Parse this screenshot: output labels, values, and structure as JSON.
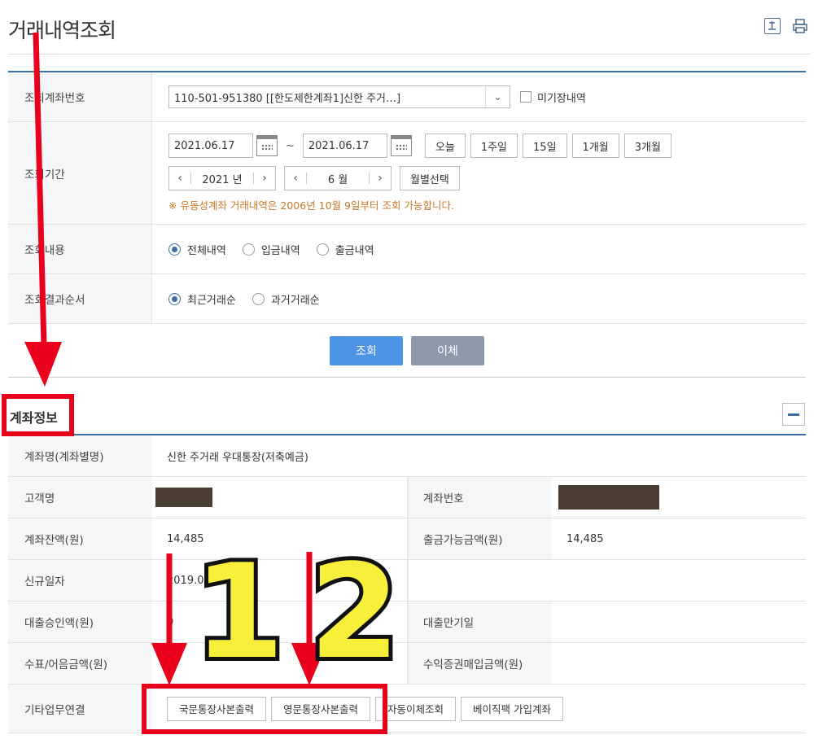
{
  "page": {
    "title": "거래내역조회"
  },
  "icons": {
    "download": "download-icon",
    "print": "print-icon"
  },
  "search": {
    "account_label": "조회계좌번호",
    "account_value": "110-501-951380 [[한도제한계좌1]신한 주거…]",
    "unposted_label": "미기장내역",
    "period_label": "조회기간",
    "date_from": "2021.06.17",
    "date_to": "2021.06.17",
    "tilde": "~",
    "quick": [
      "오늘",
      "1주일",
      "15일",
      "1개월",
      "3개월"
    ],
    "year": "2021 년",
    "month": "6 월",
    "month_select": "월별선택",
    "note": "※ 유동성계좌 거래내역은 2006년 10월 9일부터 조회 가능합니다.",
    "content_label": "조회내용",
    "content_options": [
      "전체내역",
      "입금내역",
      "출금내역"
    ],
    "order_label": "조회결과순서",
    "order_options": [
      "최근거래순",
      "과거거래순"
    ],
    "search_button": "조회",
    "transfer_button": "이체"
  },
  "account_info": {
    "section_title": "계좌정보",
    "rows": [
      {
        "label": "계좌명(계좌별명)",
        "value": "신한 주거래 우대통장(저축예금)"
      },
      {
        "label": "고객명",
        "value": "",
        "label2": "계좌번호",
        "value2": ""
      },
      {
        "label": "계좌잔액(원)",
        "value": "14,485",
        "label2": "출금가능금액(원)",
        "value2": "14,485"
      },
      {
        "label": "신규일자",
        "value": "2019.0",
        "label2": "",
        "value2": ""
      },
      {
        "label": "대출승인액(원)",
        "value": "0",
        "label2": "대출만기일",
        "value2": ""
      },
      {
        "label": "수표/어음금액(원)",
        "value": "",
        "label2": "수익증권매입금액(원)",
        "value2": ""
      }
    ],
    "other_label": "기타업무연결",
    "other_buttons": [
      "국문통장사본출력",
      "영문통장사본출력",
      "자동이체조회",
      "베이직팩 가입계좌"
    ]
  },
  "annotation": {
    "num1": "1",
    "num2": "2"
  },
  "colors": {
    "accent": "#3a6ea5",
    "search_btn": "#4d94e6",
    "transfer_btn": "#8c99a8",
    "note": "#c7792a",
    "annotation_red": "#e8001c",
    "annotation_yellow": "#f7ef3a"
  }
}
